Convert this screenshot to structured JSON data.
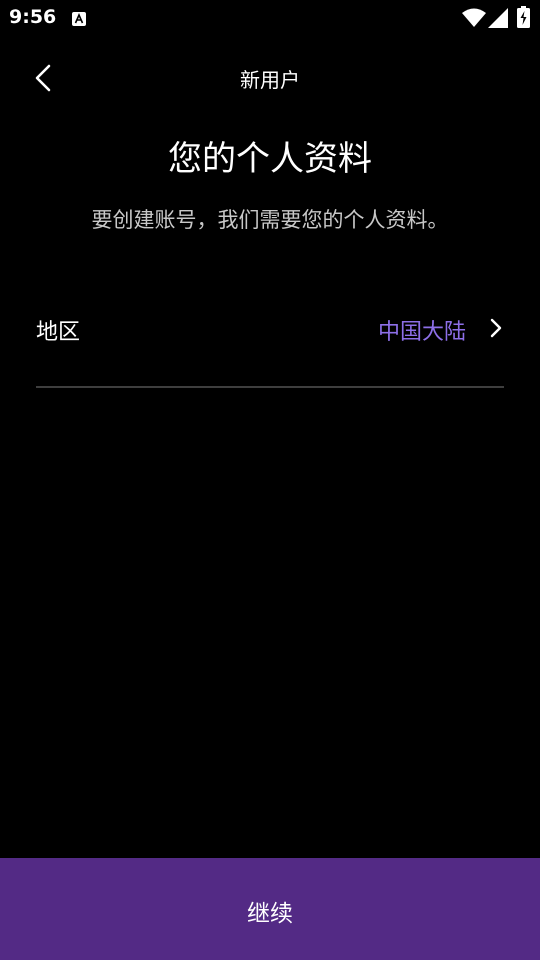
{
  "status_bar": {
    "time": "9:56",
    "notification_icon": "a-square-icon",
    "wifi_icon": "wifi-icon",
    "signal_icon": "cell-signal-icon",
    "battery_icon": "battery-charging-icon"
  },
  "header": {
    "back_icon": "chevron-left-icon",
    "title": "新用户"
  },
  "main": {
    "title": "您的个人资料",
    "subtitle": "要创建账号，我们需要您的个人资料。",
    "region_row": {
      "label": "地区",
      "value": "中国大陆",
      "chevron_icon": "chevron-right-icon"
    }
  },
  "footer": {
    "continue_label": "继续"
  },
  "colors": {
    "background": "#000000",
    "accent_text": "#8d6fe8",
    "button_background": "#532a85",
    "divider": "#3e3e3e",
    "subtitle_text": "#c8c8c8"
  }
}
